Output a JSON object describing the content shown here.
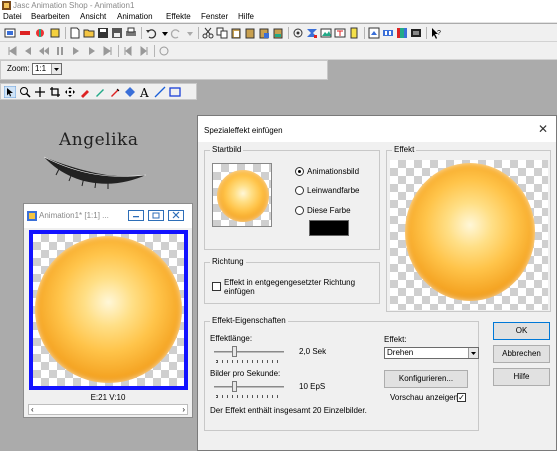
{
  "window": {
    "title": "Jasc Animation Shop - Animation1"
  },
  "menu": [
    "Datei",
    "Bearbeiten",
    "Ansicht",
    "Animation",
    "Effekte",
    "Fenster",
    "Hilfe"
  ],
  "zoom": {
    "label": "Zoom:",
    "value": "1:1"
  },
  "logo": {
    "text": "Angelika"
  },
  "animation_window": {
    "title": "Animation1* [1:1] ...",
    "frame_info": "E:21  V:10"
  },
  "dialog": {
    "title": "Spezialeffekt einfügen",
    "start_group": "Startbild",
    "radio_animation": "Animationsbild",
    "radio_canvas": "Leinwandfarbe",
    "radio_color": "Diese Farbe",
    "color_swatch": "#000000",
    "effect_preview_group": "Effekt",
    "direction_group": "Richtung",
    "direction_check_label": "Effekt in entgegengesetzter Richtung einfügen",
    "props_group": "Effekt-Eigenschaften",
    "length_label": "Effektlänge:",
    "length_value": "2,0 Sek",
    "fps_label": "Bilder pro Sekunde:",
    "fps_value": "10 EpS",
    "total_text": "Der Effekt enthält insgesamt 20 Einzelbilder.",
    "effect_label": "Effekt:",
    "effect_value": "Drehen",
    "configure_button": "Konfigurieren...",
    "preview_label": "Vorschau anzeigen",
    "preview_checked": true,
    "ok_button": "OK",
    "cancel_button": "Abbrechen",
    "help_button": "Hilfe"
  }
}
